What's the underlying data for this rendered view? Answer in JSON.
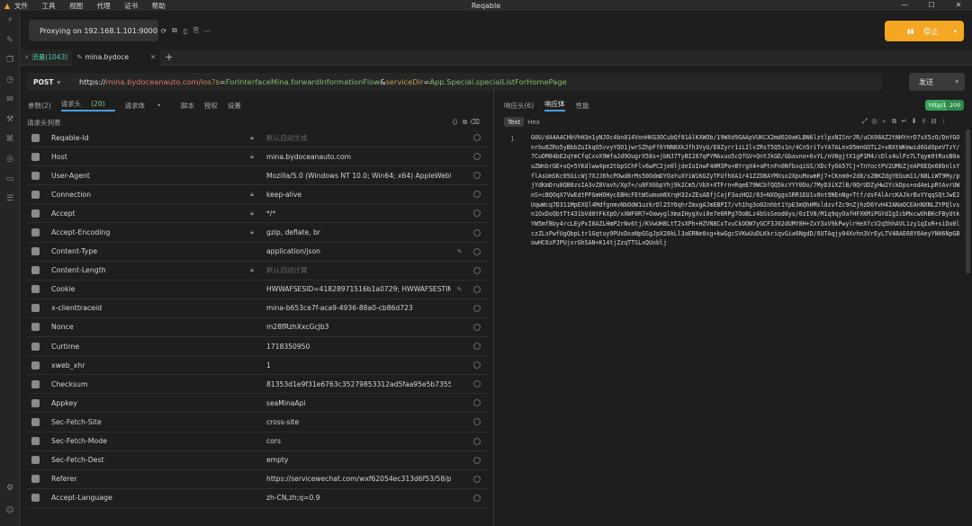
{
  "app": {
    "title": "Reqable",
    "menu": [
      "文件",
      "工具",
      "视图",
      "代理",
      "证书",
      "帮助"
    ]
  },
  "proxy": {
    "label": "Proxying on 192.168.1.101:9000",
    "stop_label": "停止"
  },
  "tabs": [
    {
      "label": "流量(1043)"
    },
    {
      "label": "mina.bydoce"
    }
  ],
  "request": {
    "method": "POST",
    "url": {
      "scheme": "https://",
      "host": "mina.bydoceanauto.com",
      "path": "/ios?",
      "param1_name": "s",
      "param1_value": "ForInterfaceMina.forwardInformationFlow",
      "param2_name": "serviceDir",
      "param2_value": "App.Special.specialListForHomePage"
    },
    "send_label": "发送",
    "subtabs": [
      {
        "label": "参数(2)"
      },
      {
        "label": "请求头",
        "count": "(20)"
      },
      {
        "label": "请求体"
      },
      {
        "label": "脚本"
      },
      {
        "label": "授权"
      },
      {
        "label": "设置"
      }
    ],
    "headers_title": "请求头列表",
    "headers": [
      {
        "key": "Reqable-Id",
        "value": "默认自动生成",
        "placeholder": true
      },
      {
        "key": "Host",
        "value": "mina.bydoceanauto.com"
      },
      {
        "key": "User-Agent",
        "value": "Mozilla/5.0 (Windows NT 10.0; Win64; x64) AppleWebKit/5..."
      },
      {
        "key": "Connection",
        "value": "keep-alive"
      },
      {
        "key": "Accept",
        "value": "*/*"
      },
      {
        "key": "Accept-Encoding",
        "value": "gzip, deflate, br"
      },
      {
        "key": "Content-Type",
        "value": "application/json"
      },
      {
        "key": "Content-Length",
        "value": "默认自动计算",
        "placeholder": true
      },
      {
        "key": "Cookie",
        "value": "HWWAFSESID=41828971516b1a0729; HWWAFSESTIM..."
      },
      {
        "key": "x-clienttraceid",
        "value": "mina-b653ce7f-aca9-4936-88a0-cb86d723"
      },
      {
        "key": "Nonce",
        "value": "m28fRzhXxcGcJb3"
      },
      {
        "key": "Curtime",
        "value": "1718350950"
      },
      {
        "key": "xweb_xhr",
        "value": "1"
      },
      {
        "key": "Checksum",
        "value": "81353d1e9f31e6763c35279853312ad5faa95e5b7355edfd4..."
      },
      {
        "key": "Appkey",
        "value": "seaMinaApi"
      },
      {
        "key": "Sec-Fetch-Site",
        "value": "cross-site"
      },
      {
        "key": "Sec-Fetch-Mode",
        "value": "cors"
      },
      {
        "key": "Sec-Fetch-Dest",
        "value": "empty"
      },
      {
        "key": "Referer",
        "value": "https://servicewechat.com/wxf62054ec313d6f53/58/page-..."
      },
      {
        "key": "Accept-Language",
        "value": "zh-CN,zh;q=0.9"
      }
    ]
  },
  "response": {
    "tabs": [
      {
        "label": "响应头(6)"
      },
      {
        "label": "响应体"
      },
      {
        "label": "性能"
      }
    ],
    "protocol": "http/1.1",
    "status": "200",
    "formats": [
      {
        "label": "Text"
      },
      {
        "label": "Hex"
      }
    ],
    "line_number": "1",
    "body": "G0U/dA4AACHbVhH3n1yNJOc4bn814VonHKG3OCubQf81AlKXWOb/19WXd9GAApVUKCX2md020aKLBN6lztlpxNISnrJR/uCK08AZ2tNHYnrD7sX5zO/DnYGOnrbu8ZRo5yBbbZuIkqO5vvyYQO1jwrSZhpFf6YNN8XkJfh3VyU/E0Zyrr1iLIlvZRsT5Q5s1n/4Cn5riTvYA7ALex05mnGOTL2+vBXtWKmwid6GdOpeVTzY/7CuOM84bE2qYmCfqCxvX9WfaJd9OugrX58s+jbNJ7TyBI267qPYMAxuo5cQfGV+QnYJkGD/Gbavno+6vYL/nV8gjtX1gP1M4/cDlx4ulPz7LTqym9tRusB0auZWnbrGE+sQ+5YKdlww4pe2tbpSChFlv6wPC2je0ljdeIoInwF4HM3Po+BYrgX4+aPtnFn0NfbxqiGS/XDcfyOA57Cj+TnYoctPV2UMbZjeAP6EQe68bnlsYflAsUmSKc05GicWj7XJJ6hcPOwd8rMs50OdmDYOaYuXYiW1KGZyTFUfhXA1r41ZZO8AYMXso2XpuMxwmRj7+CKnm0+2d8/s2BKZdgYEGum11/N8LiWT9My/pjYdKmDru8QB8zsIA3vZ8Vavh/Xp7+/u8FX6bpYhj9k2Cm5/VbX+XTFrn+RqeE79WCbfQQ5kcYYY0Do/7MyD3iXZlB/0QrUDZyHw2YckDps+odAeLpRtAvrUWnS+cBQOqX7VwEdtPFGmHOHycEBHcFEtWSumxm8XrqH32xZEsADfjCajF3azHQ2/83+NXOggsSRR1EU1v8nt9NEnNg+Ttf/dsFAlArcKAJkrBxYYqqSQtJwE2UqwWcq7D311MpEXQl4MdfgnmvNbOdW1uzkrDl25Y6qhrZmxgAJmEBPI7/vh1hg3o02nhbt1YpE3mQhHMsldzvfZc9nZjhzD6YvH42ANaOCEAnNXNLZYPQlvsn1OxDoQbtTt431bVd0tFkXpO/xXWF0R7+OawyglXmaIHygXvi0e7e6RPg7OoBLz4bSsSeod0ys/0zIV8/M1q9qyOafHFXKMiPGYdIgIcbMxcwOhBKcFByUtkYW5mfBby4rcLEyPxI8AZLHmP2rNv6tj/KVwUH8LtT2sXPh+HZVN8CxTvuCkOOW7yGCF3J02dUMY8H+ZxY3xV9kPwylrHeXfcV2q5hhAVL1zy1qIoR+siDo0lczZLsPwfUgQbpLtr1Gqtuy9PUxDxaNpGSgJpX28kLl3aERNe0xg+kwGgcSVKwUuDLKkriqvGia6NgdD/6UTAqjy04Xvhn3VrEyLTV4BAE68Y0AeyYNH6NpGBowHC6zPJPUjxrGhSAN+K14tjZzqTTSLxQUoblj"
  }
}
